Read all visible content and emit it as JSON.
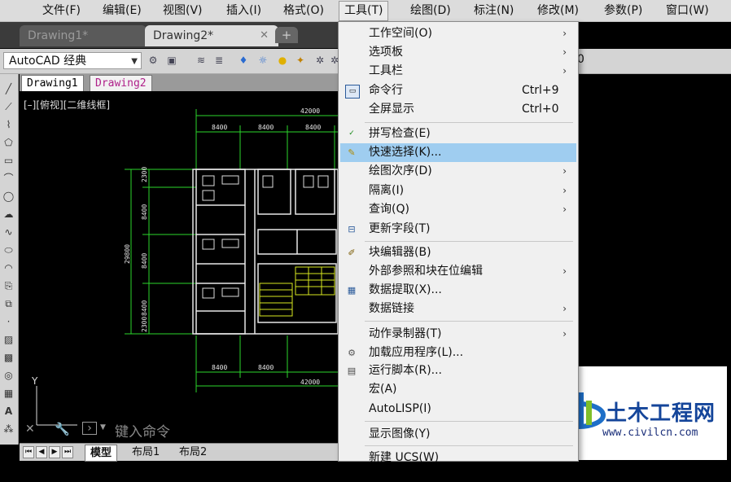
{
  "menubar": {
    "items": [
      "文件(F)",
      "编辑(E)",
      "视图(V)",
      "插入(I)",
      "格式(O)",
      "工具(T)",
      "绘图(D)",
      "标注(N)",
      "修改(M)",
      "参数(P)",
      "窗口(W)"
    ]
  },
  "doc_tabs": {
    "tab1": "Drawing1*",
    "tab2": "Drawing2*",
    "close": "✕",
    "new": "+"
  },
  "toolbar": {
    "workspace": "AutoCAD 经典",
    "right_value": "0"
  },
  "layout_tabs": {
    "a": "Drawing1",
    "b": "Drawing2"
  },
  "viewport_label": "[–][俯视][二维线框]",
  "drawing": {
    "dim_total": "42000",
    "dim_bay": "8400",
    "dim_height": "29800",
    "dim_side_a": "2300",
    "dim_side_b": "8400"
  },
  "command": {
    "placeholder": "键入命令"
  },
  "bottom_tabs": [
    "模型",
    "布局1",
    "布局2"
  ],
  "menu": {
    "items": [
      {
        "label": "工作空间(O)",
        "submenu": true
      },
      {
        "label": "选项板",
        "submenu": true
      },
      {
        "label": "工具栏",
        "submenu": true
      },
      {
        "label": "命令行",
        "shortcut": "Ctrl+9"
      },
      {
        "label": "全屏显示",
        "shortcut": "Ctrl+0"
      },
      {
        "label": "拼写检查(E)"
      },
      {
        "label": "快速选择(K)...",
        "highlighted": true
      },
      {
        "label": "绘图次序(D)",
        "submenu": true
      },
      {
        "label": "隔离(I)",
        "submenu": true
      },
      {
        "label": "查询(Q)",
        "submenu": true
      },
      {
        "label": "更新字段(T)"
      },
      {
        "label": "块编辑器(B)"
      },
      {
        "label": "外部参照和块在位编辑",
        "submenu": true
      },
      {
        "label": "数据提取(X)..."
      },
      {
        "label": "数据链接",
        "submenu": true
      },
      {
        "label": "动作录制器(T)",
        "submenu": true
      },
      {
        "label": "加载应用程序(L)..."
      },
      {
        "label": "运行脚本(R)..."
      },
      {
        "label": "宏(A)"
      },
      {
        "label": "AutoLISP(I)"
      },
      {
        "label": "显示图像(Y)"
      },
      {
        "label": "新建 UCS(W)"
      }
    ]
  },
  "watermark": {
    "title": "土木工程网",
    "url": "www.civilcn.com"
  },
  "colors": {
    "highlight": "#9fcdf0",
    "drawing_green": "#2bd62b",
    "drawing_white": "#e8e8e8"
  }
}
